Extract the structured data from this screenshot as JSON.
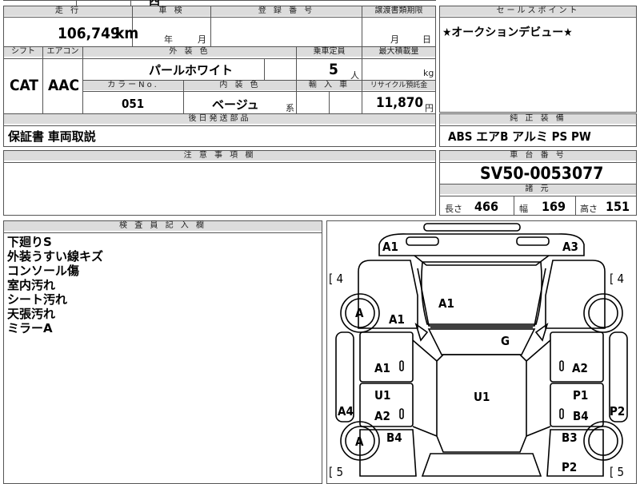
{
  "top_fragment": "西",
  "labels": {
    "mileage": "走 行",
    "inspection": "車 検",
    "registration_no": "登 録 番 号",
    "transfer_deadline": "譲渡書類期限",
    "sales_point": "セールスポイント",
    "shift": "シフト",
    "aircon": "エアコン",
    "exterior_color": "外 装 色",
    "capacity": "乗車定員",
    "max_load": "最大積載量",
    "color_no": "カラーNo.",
    "interior_color": "内 装 色",
    "import": "輸 入 車",
    "recycle_fee": "リサイクル預託金",
    "later_parts": "後日発送部品",
    "standard_equipment": "純 正 装 備",
    "notes": "注 意 事 項 欄",
    "chassis_no": "車 台 番 号",
    "dimensions": "諸 元",
    "inspector_notes": "検 査 員 記 入 欄",
    "year": "年",
    "month": "月",
    "day": "日",
    "people": "人",
    "kg": "kg",
    "yen": "円",
    "kei": "系",
    "length": "長さ",
    "width": "幅",
    "height": "高さ"
  },
  "values": {
    "mileage": "106,749",
    "mileage_unit": "km",
    "shift": "CAT",
    "aircon": "AAC",
    "exterior_color": "パールホワイト",
    "capacity": "5",
    "color_no": "051",
    "interior_color": "ベージュ",
    "recycle_fee": "11,870",
    "sales_point": "★オークションデビュー★",
    "later_parts": "保証書 車両取説",
    "standard_equipment": "ABS エアB アルミ PS PW",
    "chassis_no": "SV50-0053077",
    "length": "466",
    "width": "169",
    "height": "151"
  },
  "inspector_lines": [
    "下廻りS",
    "外装うすい線キズ",
    "コンソール傷",
    "室内汚れ",
    "シート汚れ",
    "天張汚れ",
    "ミラーA"
  ],
  "diagram": {
    "bracket_left_top": "[ 4",
    "bracket_right_top": "[ 4",
    "bracket_left_bottom": "[ 5",
    "bracket_right_bottom": "[ 5",
    "marks": {
      "front_left_corner": "A1",
      "front_right_corner": "A3",
      "hood": "A1",
      "front_left_fender": "A1",
      "windshield": "G",
      "front_left_door_upper": "A1",
      "front_right_door_upper": "A2",
      "rear_left_door_upper": "U1",
      "roof": "U1",
      "rear_right_door_upper": "P1",
      "rear_left_door_lower": "A2",
      "rear_right_door_lower": "B4",
      "left_rocker": "A4",
      "right_rocker": "P2",
      "left_quarter": "B4",
      "right_quarter": "B3",
      "rear_right_corner": "P2",
      "front_wheel_left": "A",
      "rear_wheel_left": "A"
    }
  }
}
